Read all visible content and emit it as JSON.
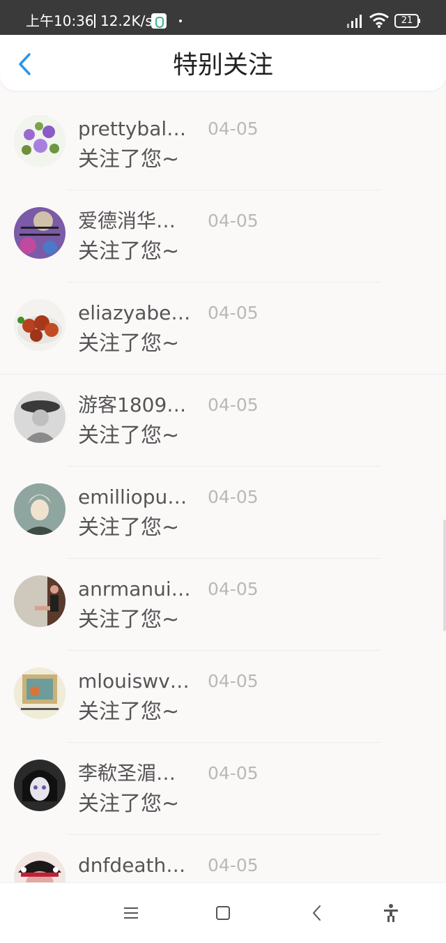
{
  "status_bar": {
    "time": "上午10:36",
    "net_speed": "12.2K/s",
    "battery": "21"
  },
  "header": {
    "title": "特别关注"
  },
  "list": [
    {
      "name": "prettybal…",
      "date": "04-05",
      "message": "关注了您~"
    },
    {
      "name": "爱德消华…",
      "date": "04-05",
      "message": "关注了您~"
    },
    {
      "name": "eliazyabe…",
      "date": "04-05",
      "message": "关注了您~"
    },
    {
      "name": "游客1809…",
      "date": "04-05",
      "message": "关注了您~"
    },
    {
      "name": "emilliopu…",
      "date": "04-05",
      "message": "关注了您~"
    },
    {
      "name": "anrmanui…",
      "date": "04-05",
      "message": "关注了您~"
    },
    {
      "name": "mlouiswv…",
      "date": "04-05",
      "message": "关注了您~"
    },
    {
      "name": "李欷圣湄…",
      "date": "04-05",
      "message": "关注了您~"
    },
    {
      "name": "dnfdeath…",
      "date": "04-05",
      "message": ""
    }
  ],
  "colors": {
    "accent": "#2c95e8",
    "status_bar": "#3a3a3a",
    "date_text": "#b8b8b8"
  }
}
